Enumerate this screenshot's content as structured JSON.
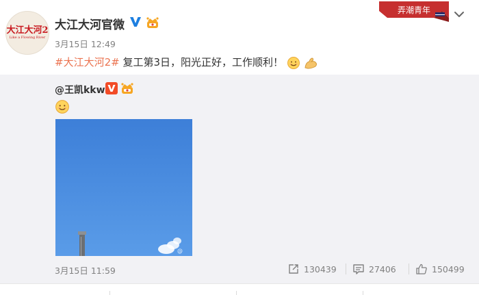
{
  "post": {
    "avatar_logo_cn": "大江大河2",
    "avatar_logo_en": "Like a Flowing River",
    "user_name": "大江大河官微",
    "time": "3月15日 12:49",
    "hashtag": "#大江大河2#",
    "text": " 复工第3日，阳光正好，工作顺利！",
    "ribbon_label": "弄潮青年"
  },
  "repost": {
    "user": "@王凯kkw",
    "photo_watermark": "@",
    "time": "3月15日 11:59",
    "share_count": "130439",
    "comment_count": "27406",
    "like_count": "150499"
  },
  "icons": {
    "verified": "verified-v-icon",
    "badge": "fan-badge-icon",
    "menu": "chevron-down-icon",
    "share": "share-icon",
    "comment": "comment-icon",
    "like": "thumbs-up-icon",
    "smile": "smile-emoji",
    "muscle": "muscle-emoji"
  },
  "colors": {
    "hashtag": "#eb7350",
    "verified": "#1d7fe0",
    "ribbon": "#c62f2f",
    "repost_bg": "#f2f2f5",
    "sky": "#4a90e2"
  }
}
